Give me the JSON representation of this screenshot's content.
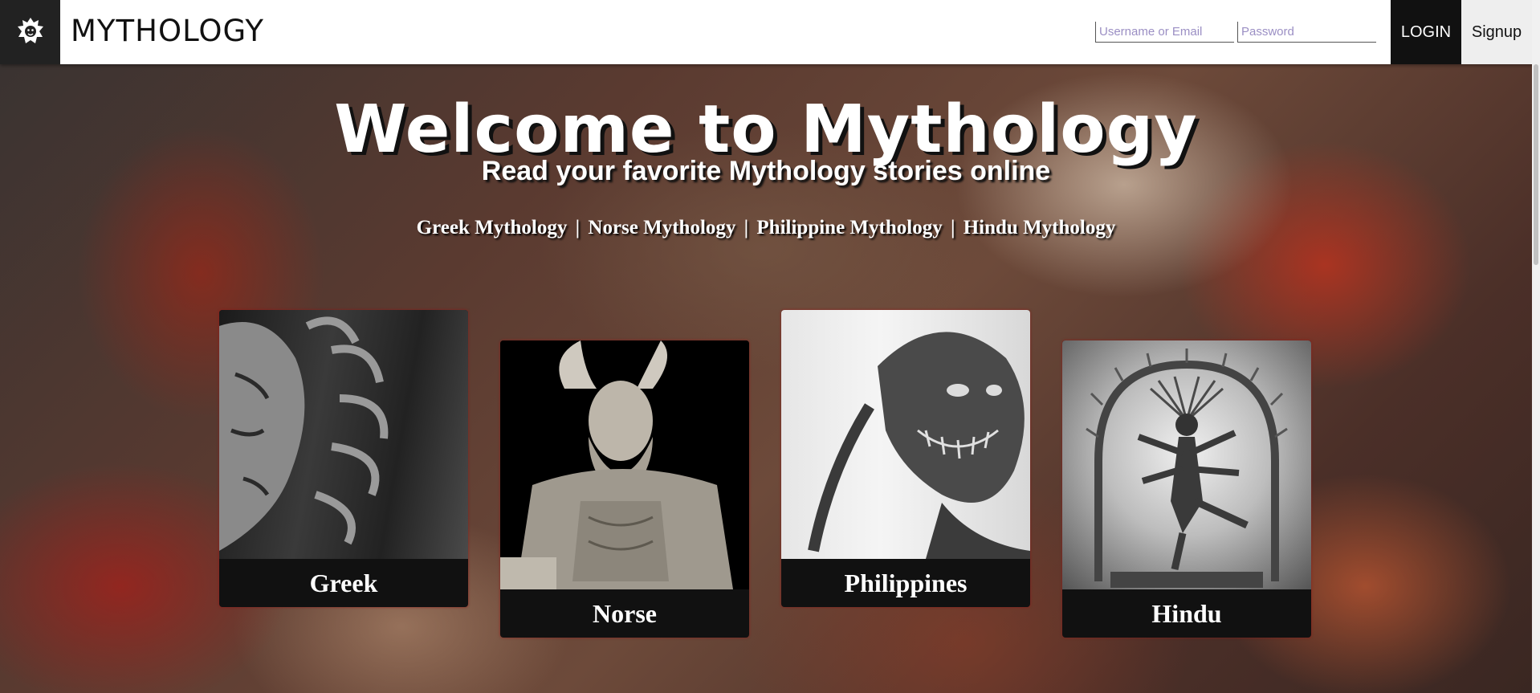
{
  "header": {
    "logo_icon": "lion-head-icon",
    "brand": "MYTHOLOGY",
    "username_placeholder": "Username or Email",
    "password_placeholder": "Password",
    "login_label": "LOGIN",
    "signup_label": "Signup"
  },
  "hero": {
    "title": "Welcome to Mythology",
    "subtitle": "Read your favorite Mythology stories online",
    "links": [
      {
        "label": "Greek Mythology"
      },
      {
        "label": "Norse Mythology"
      },
      {
        "label": "Philippine Mythology"
      },
      {
        "label": "Hindu Mythology"
      }
    ],
    "separator": "|"
  },
  "cards": [
    {
      "label": "Greek",
      "image": "medusa-statue-icon"
    },
    {
      "label": "Norse",
      "image": "viking-warrior-icon"
    },
    {
      "label": "Philippines",
      "image": "aswang-creature-icon"
    },
    {
      "label": "Hindu",
      "image": "nataraja-statue-icon"
    }
  ]
}
